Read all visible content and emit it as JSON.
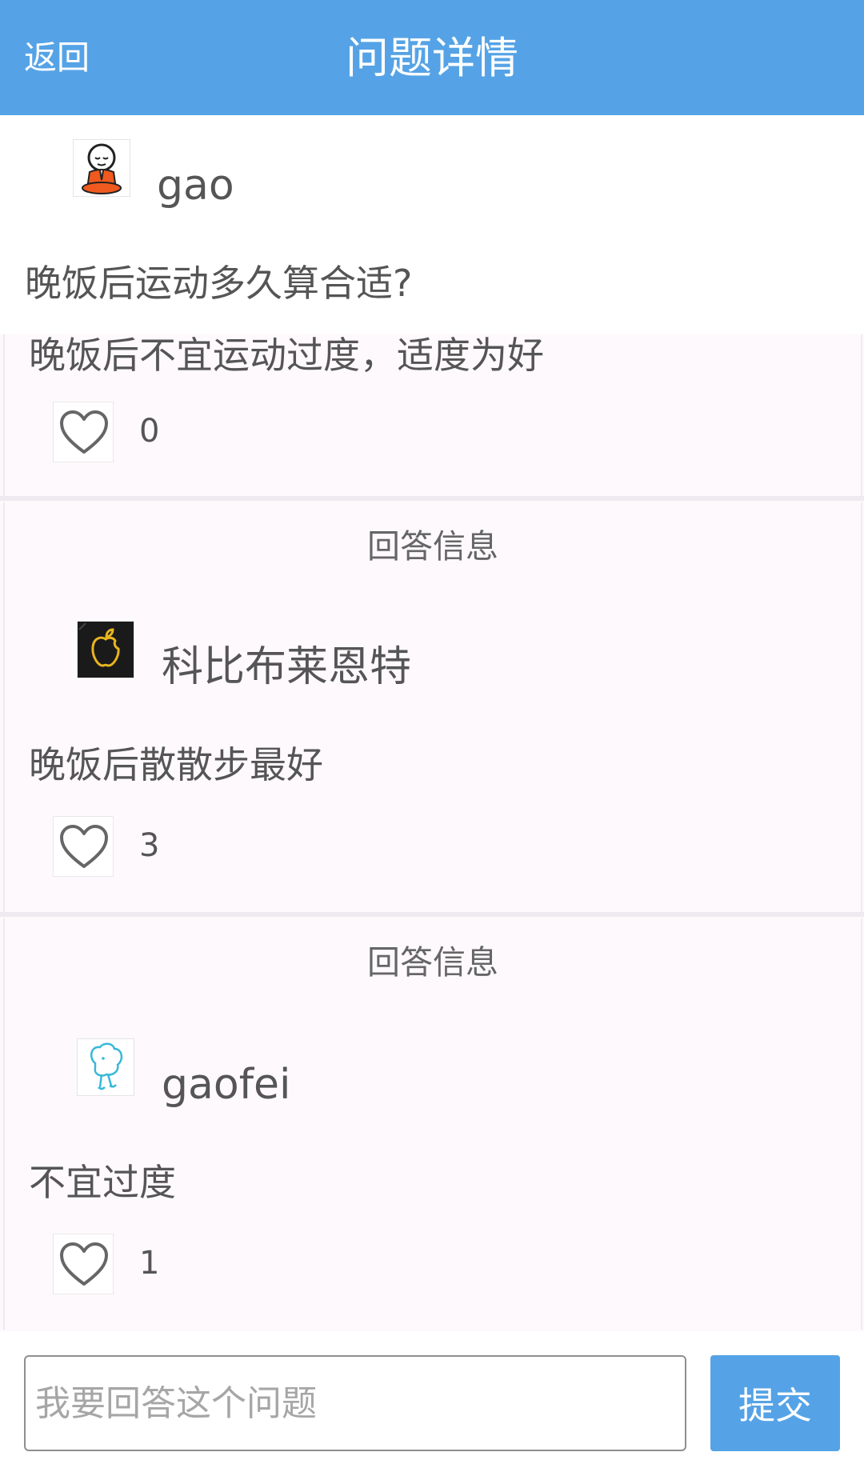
{
  "header": {
    "back_label": "返回",
    "title": "问题详情"
  },
  "question": {
    "username": "gao",
    "avatar_icon": "meditating-monk-icon",
    "text": "晚饭后运动多久算合适?"
  },
  "answers_section_label": "回答信息",
  "answers": [
    {
      "text": "晚饭后不宜运动过度，适度为好",
      "likes": "0"
    },
    {
      "username": "科比布莱恩特",
      "avatar_icon": "apple-logo-icon",
      "text": "晚饭后散散步最好",
      "likes": "3"
    },
    {
      "username": "gaofei",
      "avatar_icon": "cartoon-rabbit-icon",
      "text": "不宜过度",
      "likes": "1"
    }
  ],
  "compose": {
    "placeholder": "我要回答这个问题",
    "submit_label": "提交"
  },
  "colors": {
    "accent": "#55a3e6",
    "background": "#fcf8fc"
  }
}
